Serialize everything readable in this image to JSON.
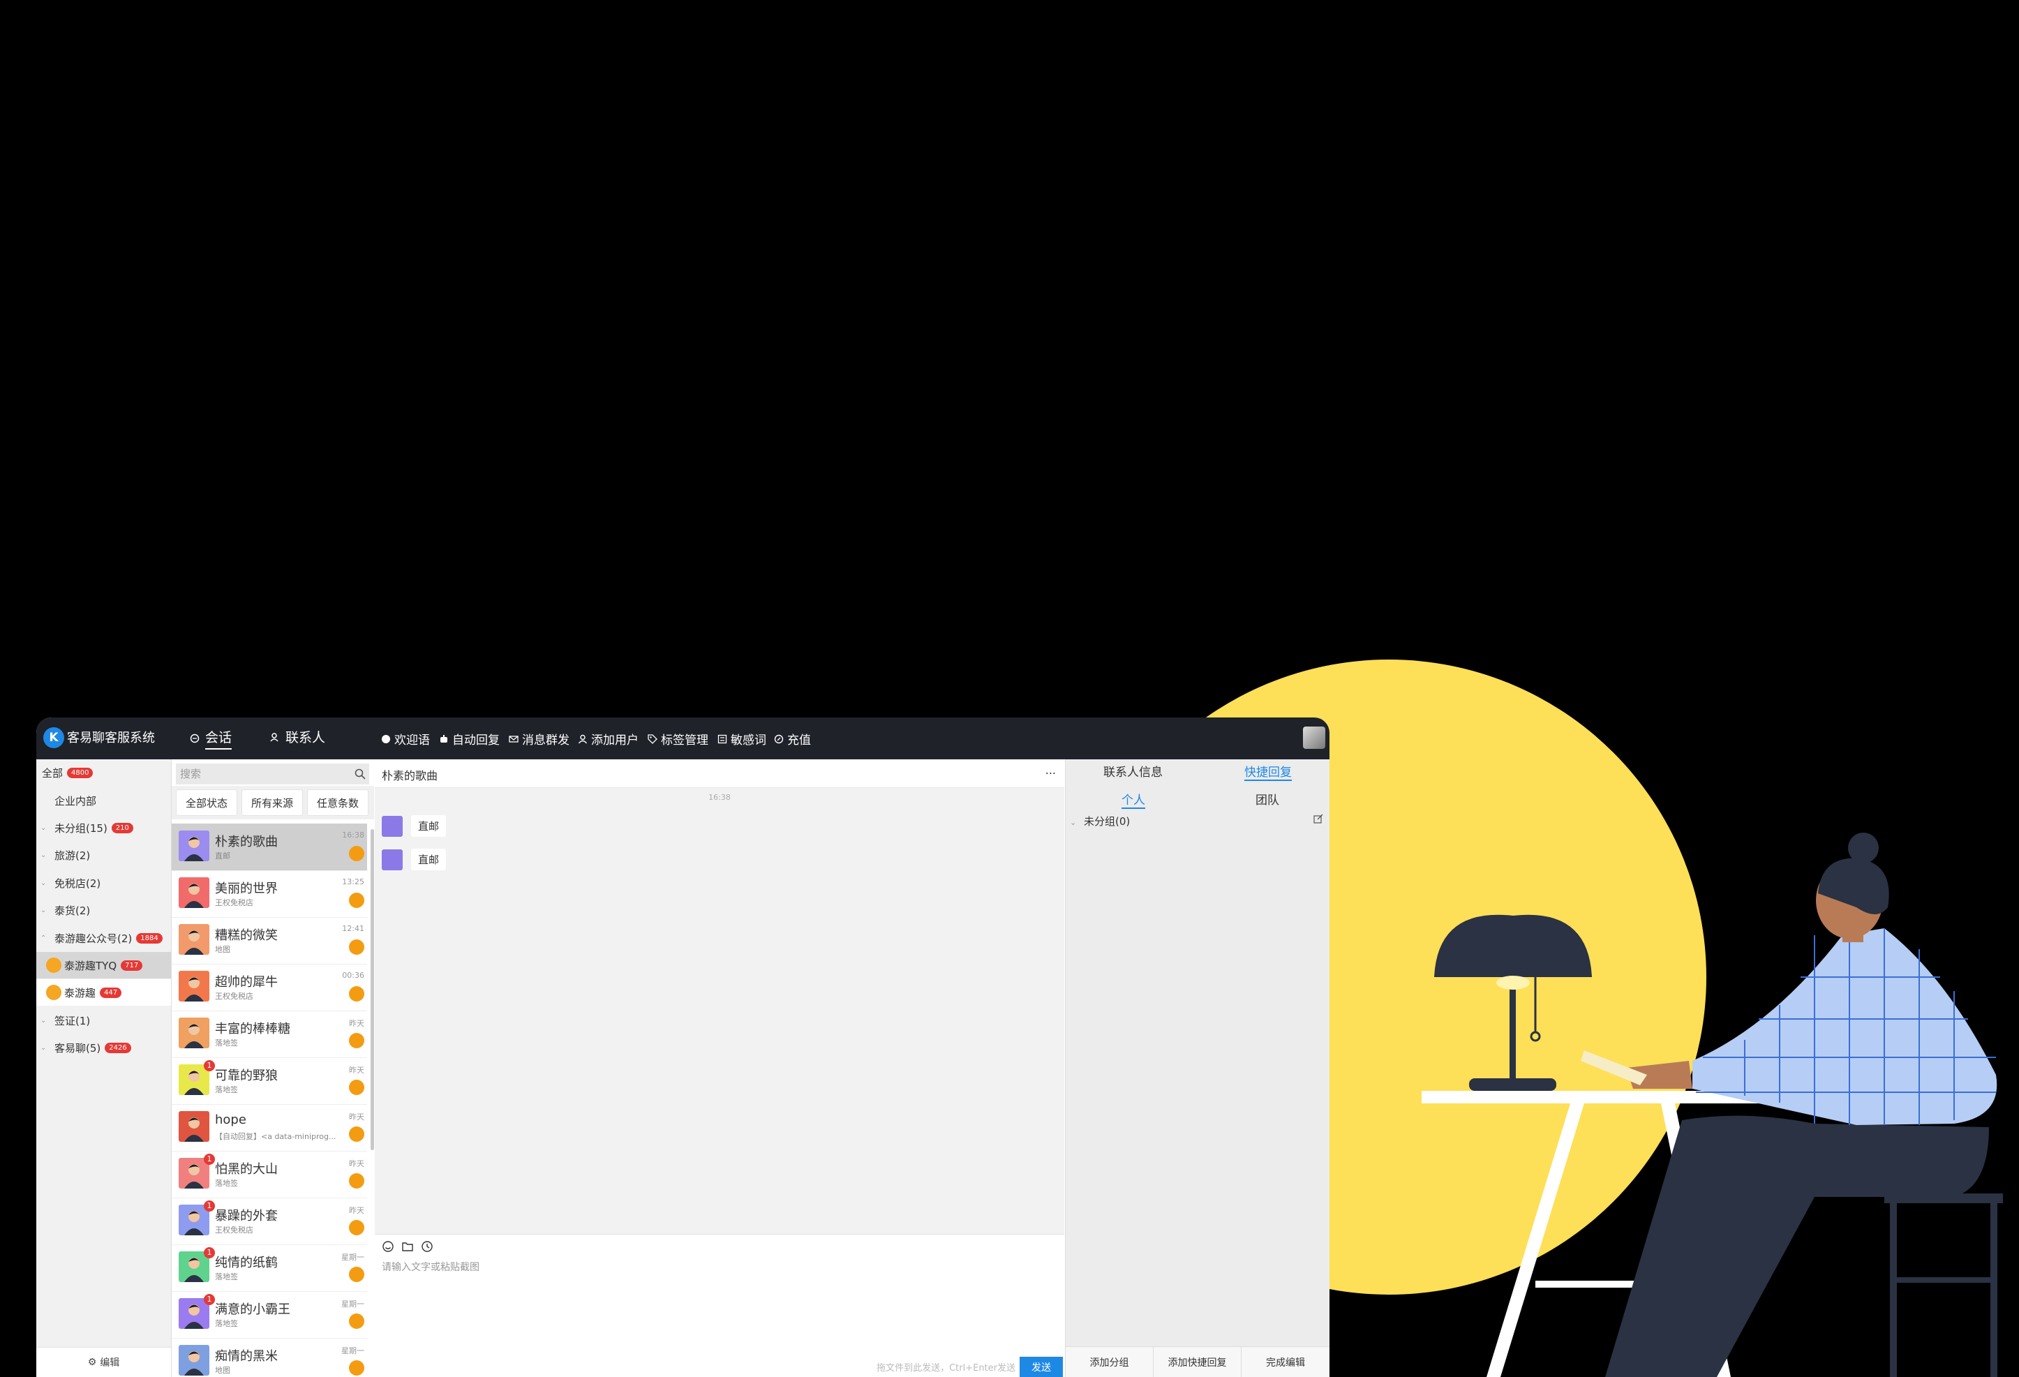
{
  "app": {
    "title": "客易聊客服系统",
    "logo_text": "K",
    "nav_tabs": [
      {
        "label": "会话",
        "icon": "chat-icon",
        "active": true
      },
      {
        "label": "联系人",
        "icon": "contacts-icon",
        "active": false
      }
    ],
    "toolbar": [
      {
        "label": "欢迎语",
        "icon": "welcome-icon"
      },
      {
        "label": "自动回复",
        "icon": "robot-icon"
      },
      {
        "label": "消息群发",
        "icon": "broadcast-icon"
      },
      {
        "label": "添加用户",
        "icon": "add-user-icon"
      },
      {
        "label": "标签管理",
        "icon": "tag-icon"
      },
      {
        "label": "敏感词",
        "icon": "sensitive-word-icon"
      },
      {
        "label": "充值",
        "icon": "recharge-icon"
      }
    ]
  },
  "sidebar": {
    "groups": [
      {
        "label": "全部",
        "badge": "4800"
      },
      {
        "label": "企业内部",
        "badge": ""
      },
      {
        "label": "未分组(15)",
        "badge": "210"
      },
      {
        "label": "旅游(2)",
        "badge": ""
      },
      {
        "label": "免税店(2)",
        "badge": ""
      },
      {
        "label": "泰货(2)",
        "badge": ""
      },
      {
        "label": "泰游趣公众号(2)",
        "badge": "1884"
      },
      {
        "label": "泰游趣TYQ",
        "badge": "717"
      },
      {
        "label": "泰游趣",
        "badge": "447"
      },
      {
        "label": "签证(1)",
        "badge": ""
      },
      {
        "label": "客易聊(5)",
        "badge": "2426"
      }
    ],
    "edit_label": "编辑"
  },
  "conversations": {
    "search_placeholder": "搜索",
    "filters": [
      "全部状态",
      "所有来源",
      "任意条数"
    ],
    "items": [
      {
        "name": "朴素的歌曲",
        "sub": "直邮",
        "time": "16:38",
        "unread": "",
        "color": "#9b8cf0"
      },
      {
        "name": "美丽的世界",
        "sub": "王权免税店",
        "time": "13:25",
        "unread": "",
        "color": "#f26b6b"
      },
      {
        "name": "糟糕的微笑",
        "sub": "地图",
        "time": "12:41",
        "unread": "",
        "color": "#f29a6b"
      },
      {
        "name": "超帅的犀牛",
        "sub": "王权免税店",
        "time": "00:36",
        "unread": "",
        "color": "#f2784b"
      },
      {
        "name": "丰富的棒棒糖",
        "sub": "落地签",
        "time": "昨天",
        "unread": "",
        "color": "#f0a060"
      },
      {
        "name": "可靠的野狼",
        "sub": "落地签",
        "time": "昨天",
        "unread": "1",
        "color": "#e8e84a"
      },
      {
        "name": "hope",
        "sub": "【自动回复】<a data-miniprog...",
        "time": "昨天",
        "unread": "",
        "color": "#e0553f"
      },
      {
        "name": "怕黑的大山",
        "sub": "落地签",
        "time": "昨天",
        "unread": "1",
        "color": "#f08080"
      },
      {
        "name": "暴躁的外套",
        "sub": "王权免税店",
        "time": "昨天",
        "unread": "1",
        "color": "#8e9cf0"
      },
      {
        "name": "纯情的纸鹤",
        "sub": "落地签",
        "time": "星期一",
        "unread": "1",
        "color": "#5fd38d"
      },
      {
        "name": "满意的小霸王",
        "sub": "落地签",
        "time": "星期一",
        "unread": "1",
        "color": "#9b7cf0"
      },
      {
        "name": "痴情的黑米",
        "sub": "地图",
        "time": "星期一",
        "unread": "",
        "color": "#7fa0e0"
      }
    ]
  },
  "chat": {
    "title": "朴素的歌曲",
    "more": "...",
    "time_divider": "16:38",
    "messages": [
      {
        "text": "直邮"
      },
      {
        "text": "直邮"
      }
    ],
    "input_placeholder": "请输入文字或粘贴截图",
    "hint": "拖文件到此发送，Ctrl+Enter发送",
    "send_label": "发送"
  },
  "right_panel": {
    "tabs": [
      {
        "label": "联系人信息",
        "active": false
      },
      {
        "label": "快捷回复",
        "active": true
      }
    ],
    "subtabs": [
      {
        "label": "个人",
        "active": true
      },
      {
        "label": "团队",
        "active": false
      }
    ],
    "group_label": "未分组(0)",
    "buttons": [
      "添加分组",
      "添加快捷回复",
      "完成编辑"
    ]
  },
  "colors": {
    "accent": "#1e88e5",
    "topbar": "#1f2229",
    "illustration_yellow": "#fedf58",
    "illustration_navy": "#2a3243",
    "shirt_blue": "#b6cdf5"
  }
}
